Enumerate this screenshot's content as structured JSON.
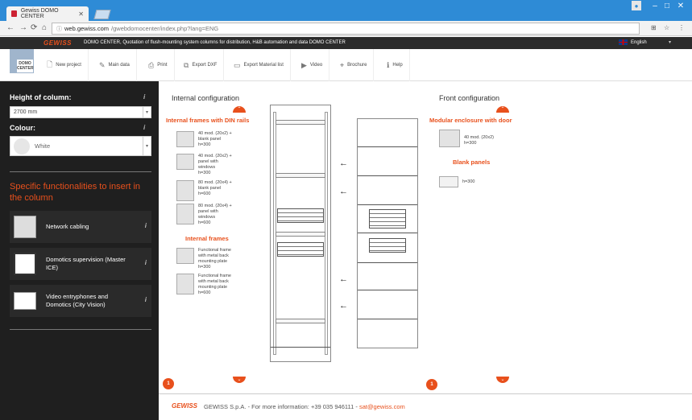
{
  "browser": {
    "tab_title": "Gewiss DOMO CENTER",
    "url_host": "web.gewiss.com",
    "url_path": "/gwebdomocenter/index.php?lang=ENG"
  },
  "header": {
    "brand": "GEWISS",
    "title": "DOMO CENTER, Quotation of flush-mounting system columns for distribution, H&B automation and data DOMO CENTER",
    "language": "English",
    "logo_line1": "DOMO",
    "logo_line2": "CENTER"
  },
  "toolbar": {
    "items": [
      {
        "label": "New project"
      },
      {
        "label": "Main data"
      },
      {
        "label": "Print"
      },
      {
        "label": "Export DXF"
      },
      {
        "label": "Export Material list"
      },
      {
        "label": "Video"
      },
      {
        "label": "Brochure"
      },
      {
        "label": "Help"
      }
    ]
  },
  "sidebar": {
    "height_label": "Height of column:",
    "height_value": "2700 mm",
    "colour_label": "Colour:",
    "colour_value": "White",
    "func_heading": "Specific functionalities to insert in the column",
    "functions": [
      {
        "label": "Network cabling"
      },
      {
        "label": "Domotics supervision (Master ICE)"
      },
      {
        "label": "Video entryphones and Domotics (City Vision)"
      }
    ]
  },
  "internal": {
    "title": "Internal configuration",
    "din_heading": "Internal frames with DIN rails",
    "din_items": [
      {
        "line1": "40 mod. (20x2) +",
        "line2": "blank panel",
        "line3": "h=300",
        "line4": ""
      },
      {
        "line1": "40 mod. (20x2) +",
        "line2": "panel with",
        "line3": "windows",
        "line4": "h=300"
      },
      {
        "line1": "80 mod. (20x4) +",
        "line2": "blank panel",
        "line3": "h=600",
        "line4": ""
      },
      {
        "line1": "80 mod. (20x4) +",
        "line2": "panel with",
        "line3": "windows",
        "line4": "h=600"
      }
    ],
    "frames_heading": "Internal frames",
    "frame_items": [
      {
        "line1": "Functional frame",
        "line2": "with metal back",
        "line3": "mounting plate",
        "line4": "h=300"
      },
      {
        "line1": "Functional frame",
        "line2": "with metal back",
        "line3": "mounting plate",
        "line4": "h=600"
      }
    ],
    "badge": "1"
  },
  "front": {
    "title": "Front configuration",
    "enclosure_heading": "Modular enclosure with door",
    "enclosure_line1": "40 mod. (20x2)",
    "enclosure_line2": "h=300",
    "blank_heading": "Blank panels",
    "blank_line1": "h=300",
    "badge": "1"
  },
  "footer": {
    "brand": "GEWISS",
    "text": "GEWISS S.p.A. - For more information: +39 035 946111 - ",
    "email": "sat@gewiss.com"
  },
  "icons": [
    "back-icon",
    "forward-icon",
    "reload-icon",
    "home-icon",
    "star-icon",
    "menu-icon",
    "info-icon",
    "arrow-left-icon",
    "chevron-up-icon",
    "chevron-down-icon"
  ],
  "colors": {
    "accent": "#e8501c",
    "chrome": "#2e8bd6",
    "dark": "#1f1f1f"
  }
}
